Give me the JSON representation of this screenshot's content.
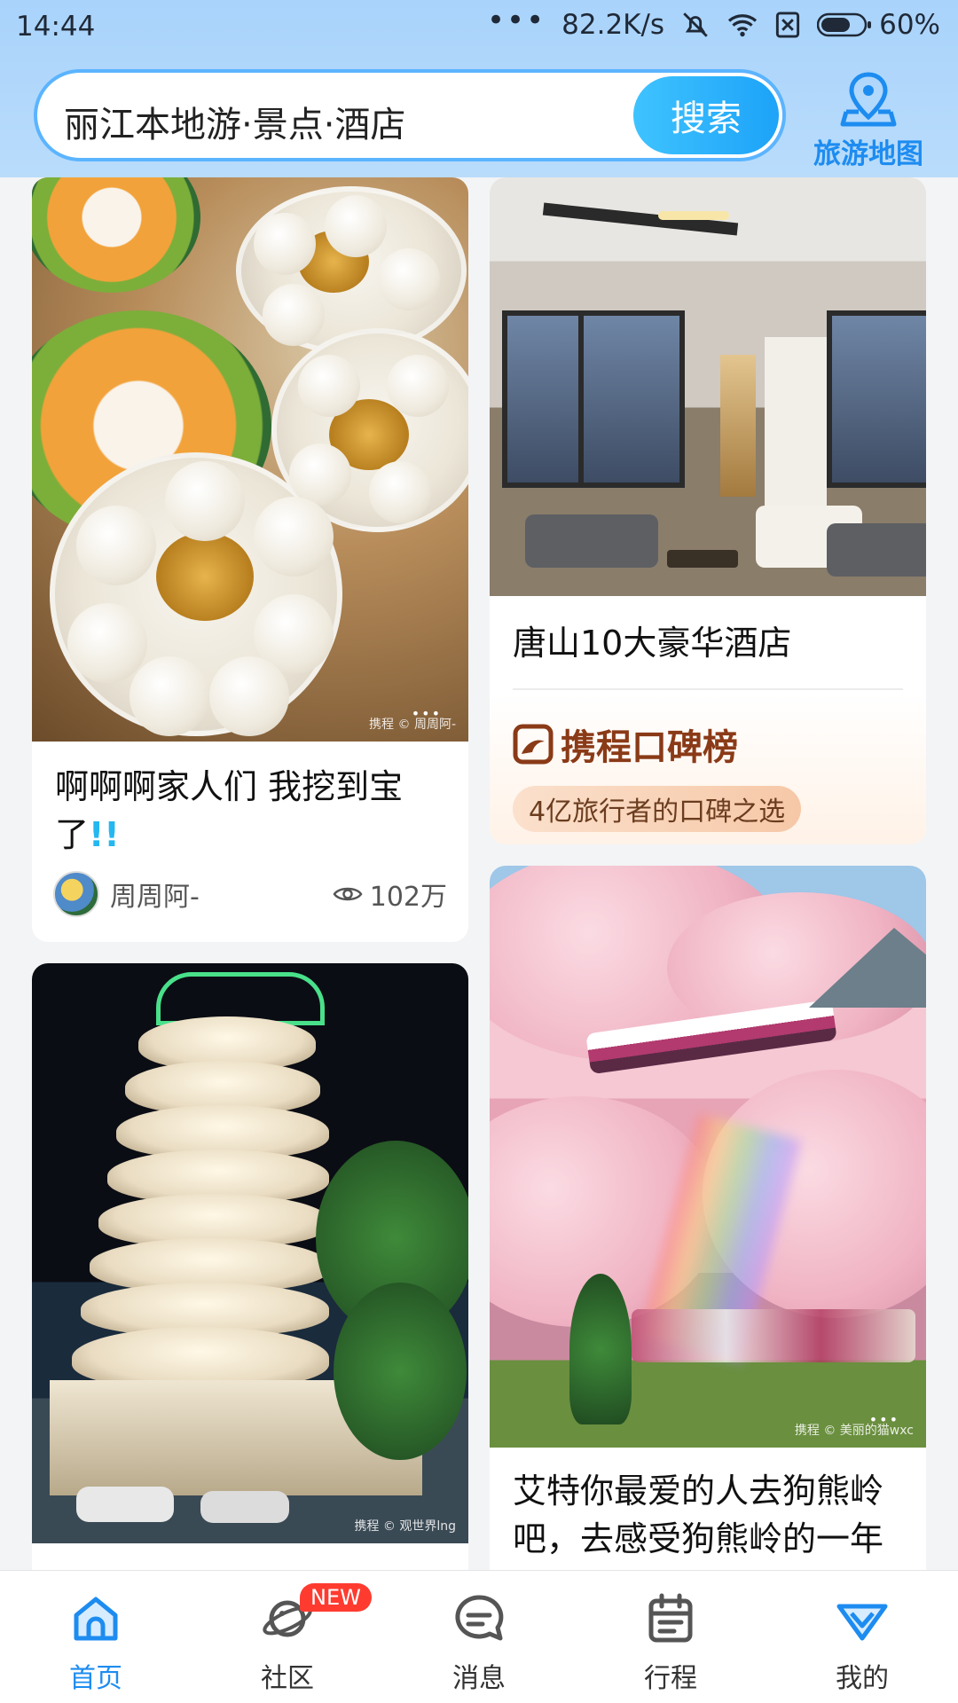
{
  "status_bar": {
    "time": "14:44",
    "net_speed": "82.2K/s",
    "battery": "60%"
  },
  "header": {
    "search_text": "丽江本地游·景点·酒店",
    "search_button": "搜索",
    "map_label": "旅游地图"
  },
  "feed": {
    "card1": {
      "watermark": "携程 © 周周阿-",
      "title": "啊啊啊家人们 我挖到宝了",
      "title_suffix": "!!",
      "author": "周周阿-",
      "views": "102万"
    },
    "card2": {
      "title": "唐山10大豪华酒店",
      "brand": "携程口碑榜",
      "tagline": "4亿旅行者的口碑之选"
    },
    "card3": {
      "watermark": "携程 © 观世界lng"
    },
    "card4": {
      "watermark": "携程 © 美丽的猫wxc",
      "title": "艾特你最爱的人去狗熊岭吧，去感受狗熊岭的一年四季"
    }
  },
  "tabbar": {
    "tabs": [
      {
        "label": "首页"
      },
      {
        "label": "社区",
        "badge": "NEW"
      },
      {
        "label": "消息"
      },
      {
        "label": "行程"
      },
      {
        "label": "我的"
      }
    ]
  },
  "colors": {
    "accent": "#1d8cf0",
    "badge": "#ff3b30",
    "brand_brown": "#8a3a17"
  }
}
